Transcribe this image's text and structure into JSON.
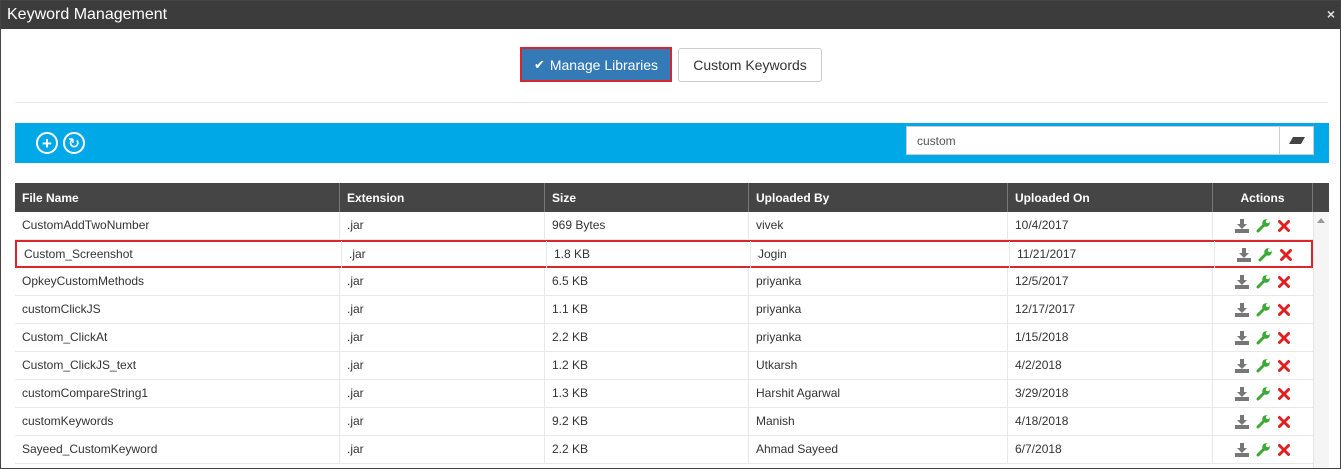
{
  "window": {
    "title": "Keyword Management",
    "close_label": "×"
  },
  "tabs": {
    "manage_libraries": "Manage Libraries",
    "custom_keywords": "Custom Keywords"
  },
  "toolbar": {
    "add_label": "+",
    "refresh_label": "↻",
    "search_value": "custom"
  },
  "table": {
    "columns": [
      "File Name",
      "Extension",
      "Size",
      "Uploaded By",
      "Uploaded On",
      "Actions"
    ],
    "rows": [
      {
        "file_name": "CustomAddTwoNumber",
        "extension": ".jar",
        "size": "969 Bytes",
        "uploaded_by": "vivek",
        "uploaded_on": "10/4/2017"
      },
      {
        "file_name": "Custom_Screenshot",
        "extension": ".jar",
        "size": "1.8 KB",
        "uploaded_by": "Jogin",
        "uploaded_on": "11/21/2017"
      },
      {
        "file_name": "OpkeyCustomMethods",
        "extension": ".jar",
        "size": "6.5 KB",
        "uploaded_by": "priyanka",
        "uploaded_on": "12/5/2017"
      },
      {
        "file_name": "customClickJS",
        "extension": ".jar",
        "size": "1.1 KB",
        "uploaded_by": "priyanka",
        "uploaded_on": "12/17/2017"
      },
      {
        "file_name": "Custom_ClickAt",
        "extension": ".jar",
        "size": "2.2 KB",
        "uploaded_by": "priyanka",
        "uploaded_on": "1/15/2018"
      },
      {
        "file_name": "Custom_ClickJS_text",
        "extension": ".jar",
        "size": "1.2 KB",
        "uploaded_by": "Utkarsh",
        "uploaded_on": "4/2/2018"
      },
      {
        "file_name": "customCompareString1",
        "extension": ".jar",
        "size": "1.3 KB",
        "uploaded_by": "Harshit Agarwal",
        "uploaded_on": "3/29/2018"
      },
      {
        "file_name": "customKeywords",
        "extension": ".jar",
        "size": "9.2 KB",
        "uploaded_by": "Manish",
        "uploaded_on": "4/18/2018"
      },
      {
        "file_name": "Sayeed_CustomKeyword",
        "extension": ".jar",
        "size": "2.2 KB",
        "uploaded_by": "Ahmad Sayeed",
        "uploaded_on": "6/7/2018"
      }
    ]
  },
  "colors": {
    "toolbar": "#00a8e8",
    "primary_button": "#337ab7",
    "highlight_border": "#d9262c",
    "header": "#454545",
    "delete": "#e02020",
    "edit": "#3aa935",
    "download": "#777777"
  },
  "icons": {
    "add": "plus-circle-icon",
    "refresh": "refresh-circle-icon",
    "clear": "eraser-icon",
    "download": "download-icon",
    "edit": "wrench-icon",
    "delete": "delete-x-icon",
    "check": "check-icon"
  }
}
